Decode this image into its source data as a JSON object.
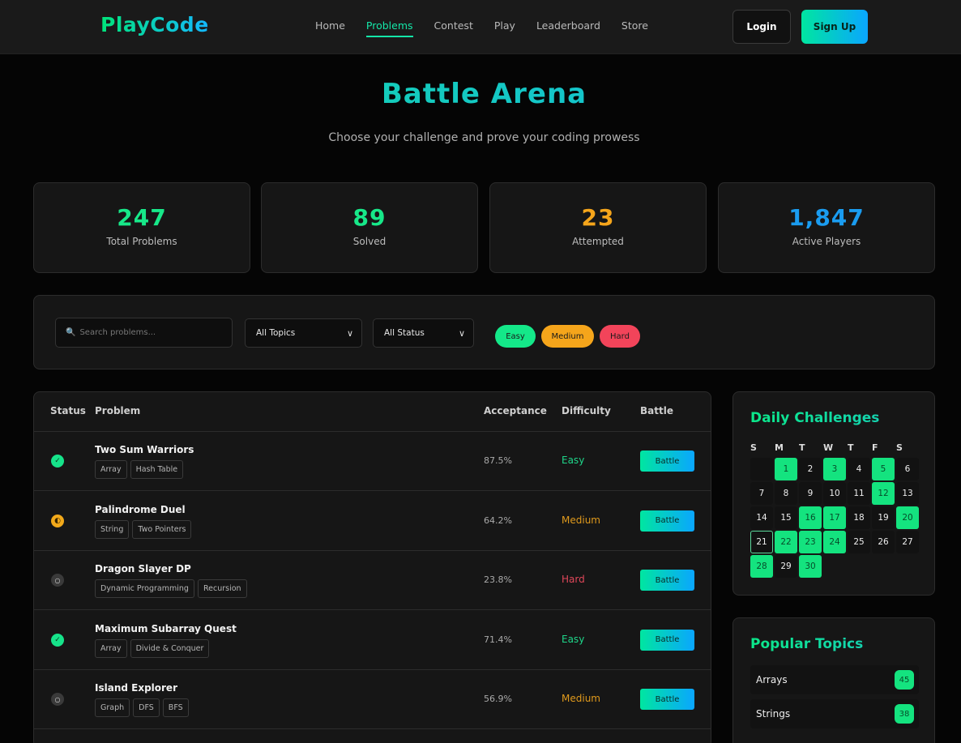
{
  "nav": {
    "logo": "PlayCode",
    "links": [
      "Home",
      "Problems",
      "Contest",
      "Play",
      "Leaderboard",
      "Store"
    ],
    "active": "Problems",
    "login": "Login",
    "signup": "Sign Up"
  },
  "hero": {
    "title": "Battle Arena",
    "subtitle": "Choose your challenge and prove your coding prowess"
  },
  "stats": [
    {
      "value": "247",
      "label": "Total Problems",
      "color": "#17e889"
    },
    {
      "value": "89",
      "label": "Solved",
      "color": "#17e889"
    },
    {
      "value": "23",
      "label": "Attempted",
      "color": "#f5a51b"
    },
    {
      "value": "1,847",
      "label": "Active Players",
      "color": "#1a9cf0"
    }
  ],
  "filters": {
    "search_placeholder": "Search problems...",
    "topics": "All Topics",
    "status": "All Status",
    "difficulty_pills": [
      {
        "label": "Easy",
        "color": "#14e889"
      },
      {
        "label": "Medium",
        "color": "#f5a51b"
      },
      {
        "label": "Hard",
        "color": "#f2445a"
      }
    ]
  },
  "table": {
    "headers": {
      "status": "Status",
      "problem": "Problem",
      "acceptance": "Acceptance",
      "difficulty": "Difficulty",
      "battle": "Battle"
    },
    "rows": [
      {
        "status": "solved",
        "status_icon": "✓",
        "title": "Two Sum Warriors",
        "tags": [
          "Array",
          "Hash Table"
        ],
        "acceptance": "87.5%",
        "difficulty": "Easy",
        "battle": "Battle"
      },
      {
        "status": "attempted",
        "status_icon": "◐",
        "title": "Palindrome Duel",
        "tags": [
          "String",
          "Two Pointers"
        ],
        "acceptance": "64.2%",
        "difficulty": "Medium",
        "battle": "Battle"
      },
      {
        "status": "none",
        "status_icon": "○",
        "title": "Dragon Slayer DP",
        "tags": [
          "Dynamic Programming",
          "Recursion"
        ],
        "acceptance": "23.8%",
        "difficulty": "Hard",
        "battle": "Battle"
      },
      {
        "status": "solved",
        "status_icon": "✓",
        "title": "Maximum Subarray Quest",
        "tags": [
          "Array",
          "Divide & Conquer"
        ],
        "acceptance": "71.4%",
        "difficulty": "Easy",
        "battle": "Battle"
      },
      {
        "status": "none",
        "status_icon": "○",
        "title": "Island Explorer",
        "tags": [
          "Graph",
          "DFS",
          "BFS"
        ],
        "acceptance": "56.9%",
        "difficulty": "Medium",
        "battle": "Battle"
      }
    ],
    "difficulty_colors": {
      "Easy": "#1fd68a",
      "Medium": "#e09a1c",
      "Hard": "#e0475a"
    }
  },
  "daily": {
    "title": "Daily Challenges",
    "weekdays": [
      "S",
      "M",
      "T",
      "W",
      "T",
      "F",
      "S"
    ],
    "leading_blanks": 1,
    "days": [
      1,
      2,
      3,
      4,
      5,
      6,
      7,
      8,
      9,
      10,
      11,
      12,
      13,
      14,
      15,
      16,
      17,
      18,
      19,
      20,
      21,
      22,
      23,
      24,
      25,
      26,
      27,
      28,
      29,
      30
    ],
    "completed": [
      1,
      3,
      5,
      12,
      16,
      17,
      20,
      22,
      23,
      24,
      28,
      30
    ],
    "today": 21
  },
  "topics": {
    "title": "Popular Topics",
    "items": [
      {
        "name": "Arrays",
        "count": "45"
      },
      {
        "name": "Strings",
        "count": "38"
      }
    ]
  }
}
